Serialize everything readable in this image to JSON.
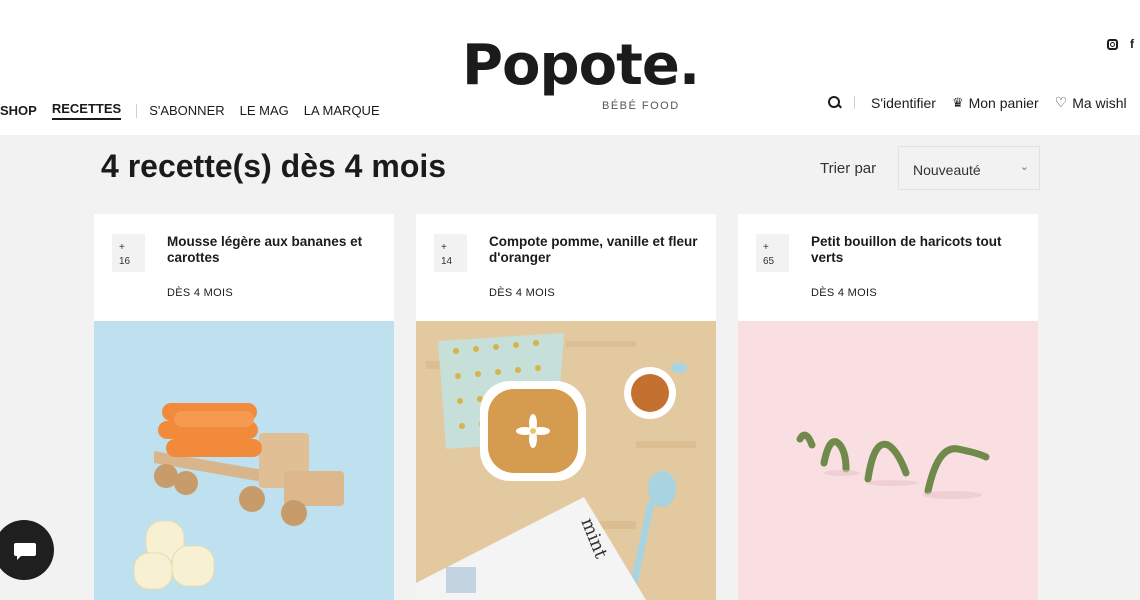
{
  "header": {
    "nav_left": [
      {
        "label": "SHOP",
        "bold": true
      },
      {
        "label": "RECETTES",
        "bold": true,
        "active": true
      },
      {
        "label": "S'ABONNER"
      },
      {
        "label": "LE MAG"
      },
      {
        "label": "LA MARQUE"
      }
    ],
    "logo": {
      "name": "Popote.",
      "tagline": "BÉBÉ FOOD"
    },
    "social": [
      {
        "icon": "instagram-icon"
      },
      {
        "icon": "facebook-icon",
        "glyph": "f"
      }
    ],
    "nav_right": {
      "login": "S'identifier",
      "cart": "Mon panier",
      "wishlist": "Ma wishl"
    }
  },
  "main": {
    "title": "4 recette(s) dès 4 mois",
    "sort": {
      "label": "Trier par",
      "selected": "Nouveauté"
    }
  },
  "recipes": [
    {
      "likes_plus": "+",
      "likes": "16",
      "title": "Mousse légère aux bananes et carottes",
      "age": "DÈS 4 MOIS",
      "image_bg": "#bfe0ef"
    },
    {
      "likes_plus": "+",
      "likes": "14",
      "title": "Compote pomme, vanille et fleur d'oranger",
      "age": "DÈS 4 MOIS",
      "image_bg": "#e3c9a0"
    },
    {
      "likes_plus": "+",
      "likes": "65",
      "title": "Petit bouillon de haricots tout verts",
      "age": "DÈS 4 MOIS",
      "image_bg": "#f9dee2"
    }
  ],
  "image_text": {
    "magazine": "mint"
  },
  "icons": {
    "search": "search-icon",
    "cart": "basket-icon",
    "wishlist": "heart-icon",
    "chat": "chat-icon"
  }
}
